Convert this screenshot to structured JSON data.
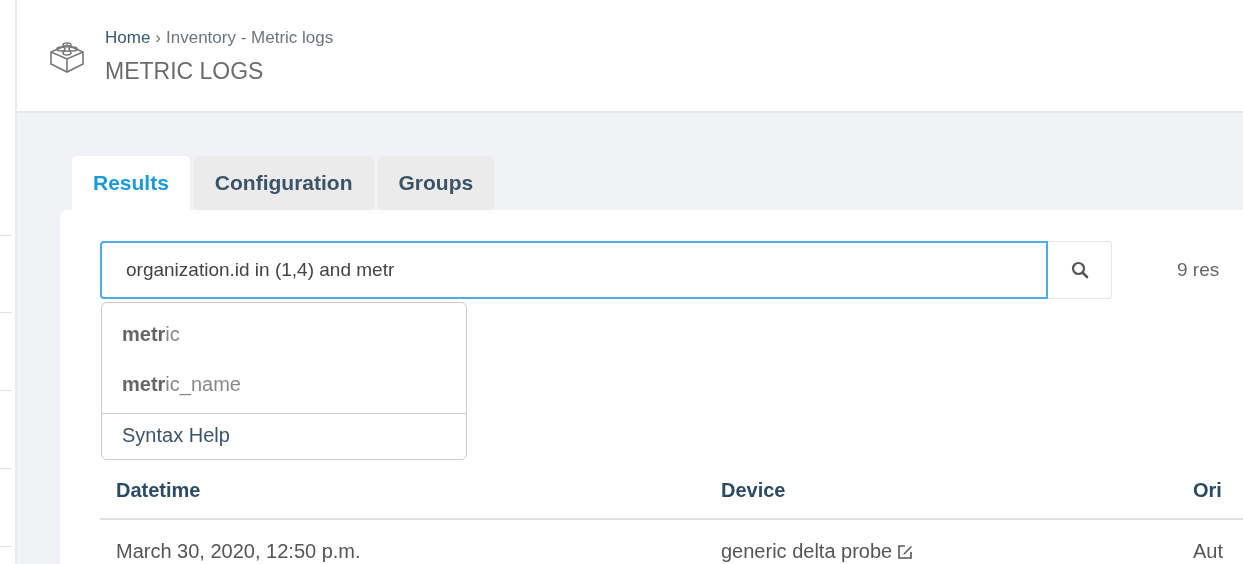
{
  "header": {
    "breadcrumb_home": "Home",
    "breadcrumb_separator": "›",
    "breadcrumb_rest": "Inventory - Metric logs",
    "title": "METRIC LOGS"
  },
  "tabs": [
    {
      "label": "Results",
      "selected": true
    },
    {
      "label": "Configuration",
      "selected": false
    },
    {
      "label": "Groups",
      "selected": false
    }
  ],
  "search": {
    "value": "organization.id in (1,4) and metr"
  },
  "suggestions": [
    {
      "label": "**metr**ic"
    },
    {
      "label": "**metr**ic_name"
    }
  ],
  "syntax_help": "Syntax Help",
  "result_count": "9 res",
  "table": {
    "columns": [
      "Datetime",
      "Device",
      "Ori"
    ],
    "rows": [
      {
        "cells": [
          "March 30, 2020, 12:50 p.m.",
          "generic delta probe",
          "Aut"
        ]
      }
    ]
  }
}
